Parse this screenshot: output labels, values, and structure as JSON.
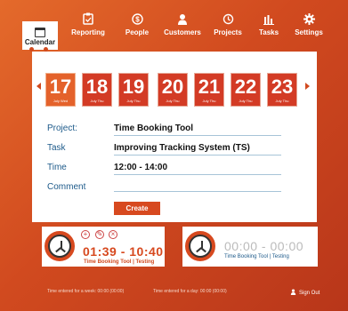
{
  "nav": {
    "items": [
      {
        "label": "Calendar",
        "icon": "calendar-icon",
        "active": true
      },
      {
        "label": "Reporting",
        "icon": "clipboard-icon"
      },
      {
        "label": "People",
        "icon": "dollar-icon"
      },
      {
        "label": "Customers",
        "icon": "person-icon"
      },
      {
        "label": "Projects",
        "icon": "history-icon"
      },
      {
        "label": "Tasks",
        "icon": "bar-chart-icon"
      },
      {
        "label": "Settings",
        "icon": "gear-icon"
      }
    ]
  },
  "dates": [
    {
      "day": "17",
      "sub": "July Wed",
      "selected": true
    },
    {
      "day": "18",
      "sub": "July Thu"
    },
    {
      "day": "19",
      "sub": "July Thu"
    },
    {
      "day": "20",
      "sub": "July Thu"
    },
    {
      "day": "21",
      "sub": "July Thu"
    },
    {
      "day": "22",
      "sub": "July Thu"
    },
    {
      "day": "23",
      "sub": "July Thu"
    }
  ],
  "form": {
    "project_label": "Project:",
    "project_value": "Time Booking Tool",
    "task_label": "Task",
    "task_value": "Improving Tracking  System (TS)",
    "time_label": "Time",
    "time_value": "12:00  - 14:00",
    "comment_label": "Comment",
    "comment_value": "",
    "create_label": "Create"
  },
  "timers": [
    {
      "time": "01:39 - 10:40",
      "subtitle": "Time Booking Tool | Testing",
      "active": true,
      "controls": [
        "+",
        "✎",
        "×"
      ]
    },
    {
      "time": "00:00  - 00:00",
      "subtitle": "Time Booking Tool | Testing",
      "active": false
    }
  ],
  "footer": {
    "week": "Time entered for a week: 00:00 (00:00)",
    "day": "Time entered for a day: 00:00 (00:00)",
    "signout": "Sign Out"
  },
  "colors": {
    "accent": "#d7491f",
    "label_blue": "#1d5a8a"
  }
}
